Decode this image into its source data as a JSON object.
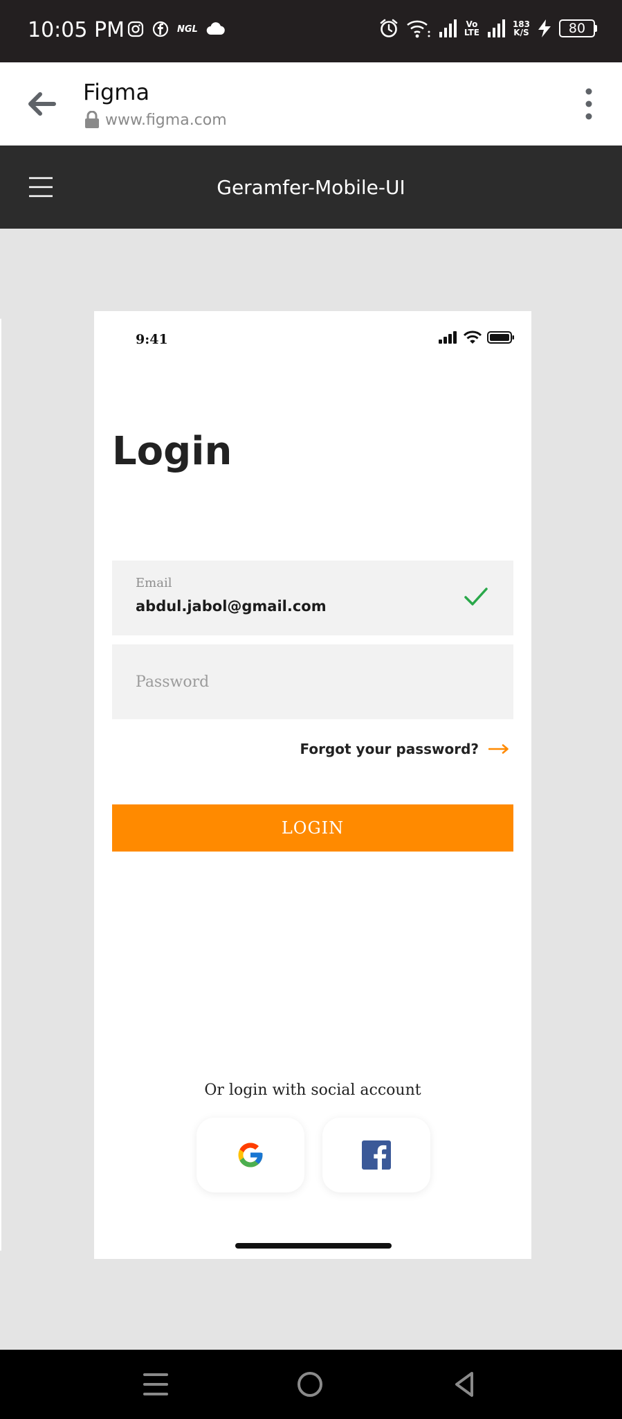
{
  "status_bar": {
    "time": "10:05 PM",
    "notification_icons": [
      "instagram-icon",
      "facebook-icon",
      "ngl-icon",
      "cloud-icon"
    ],
    "ngl_label": "NGL",
    "network_label_top": "Vo",
    "network_label_bottom": "LTE",
    "speed_value": "183",
    "speed_unit": "K/S",
    "battery": "80"
  },
  "browser": {
    "title": "Figma",
    "url": "www.figma.com"
  },
  "figma_header": {
    "title": "Geramfer-Mobile-UI"
  },
  "phone": {
    "time": "9:41",
    "title": "Login",
    "email": {
      "label": "Email",
      "value": "abdul.jabol@gmail.com"
    },
    "password": {
      "placeholder": "Password"
    },
    "forgot_label": "Forgot your password?",
    "login_label": "LOGIN",
    "social_caption": "Or login with social account"
  },
  "colors": {
    "accent": "#ff8a00",
    "check": "#2aa84a",
    "facebook": "#3b5998"
  }
}
